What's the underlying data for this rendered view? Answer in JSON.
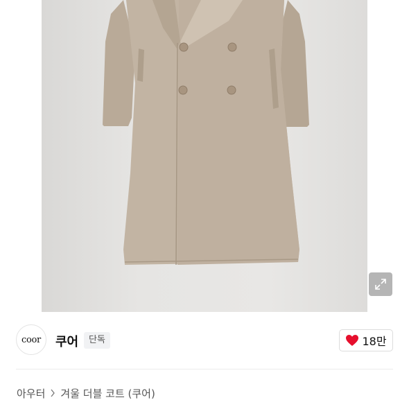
{
  "brand": {
    "logo_text": "coor",
    "name": "쿠어",
    "badge": "단독"
  },
  "like": {
    "count": "18만",
    "icon": "heart-icon",
    "color": "#e60f2d"
  },
  "breadcrumb": {
    "category": "아우터",
    "separator_icon": "chevron-right-icon",
    "product": "겨울 더블 코트 (쿠어)"
  },
  "image": {
    "alt": "",
    "expand_icon": "expand-icon"
  }
}
